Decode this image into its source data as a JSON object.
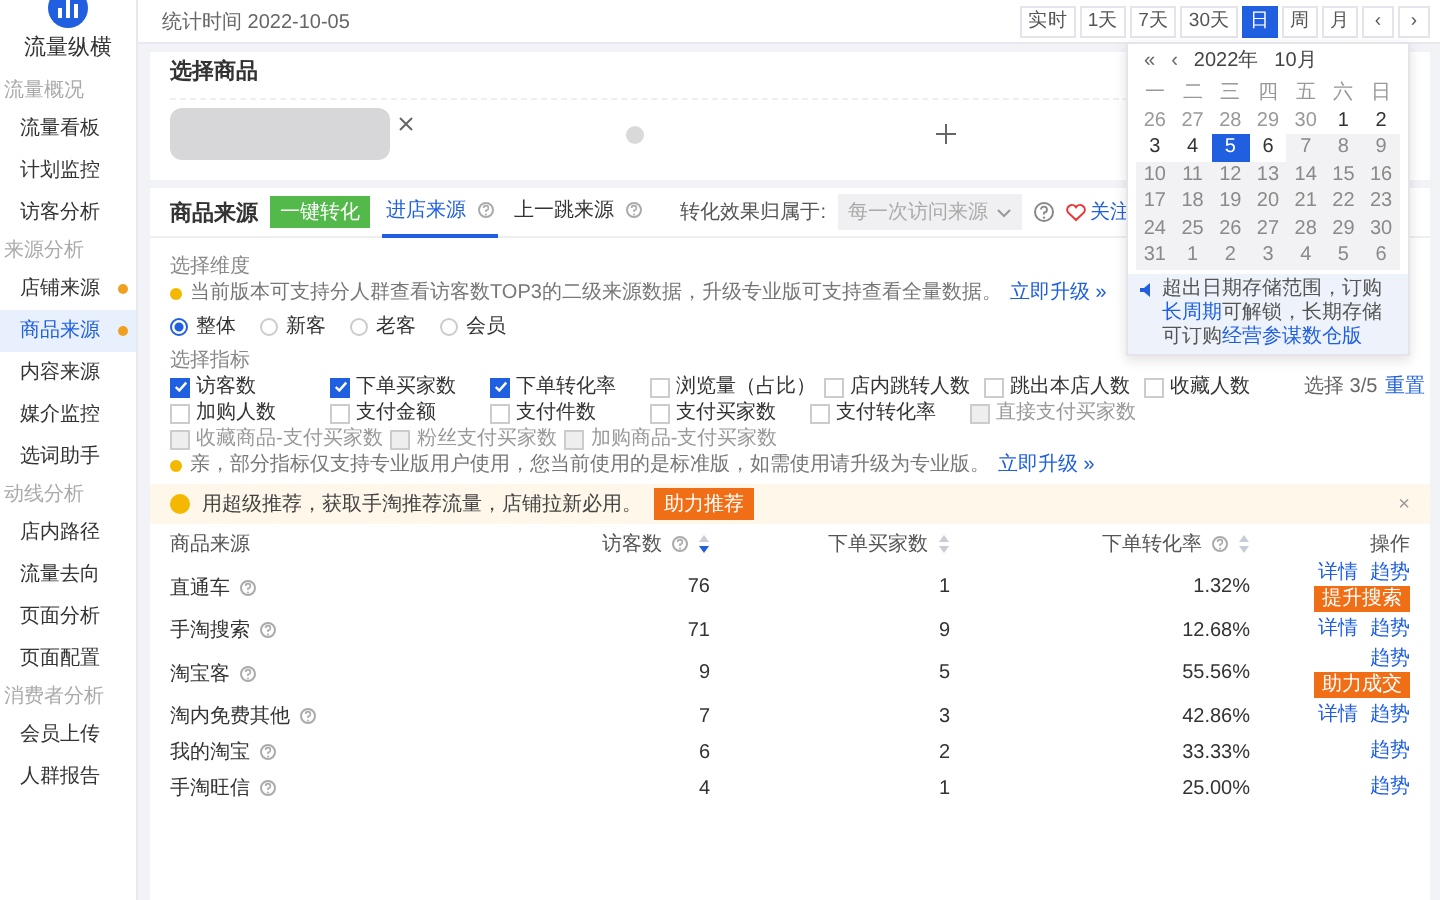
{
  "sidebar": {
    "title": "流量纵横",
    "groups": [
      {
        "label": "流量概况",
        "items": [
          {
            "label": "流量看板",
            "selected": false,
            "dot": false
          },
          {
            "label": "计划监控",
            "selected": false,
            "dot": false
          },
          {
            "label": "访客分析",
            "selected": false,
            "dot": false
          }
        ]
      },
      {
        "label": "来源分析",
        "items": [
          {
            "label": "店铺来源",
            "selected": false,
            "dot": true
          },
          {
            "label": "商品来源",
            "selected": true,
            "dot": true
          },
          {
            "label": "内容来源",
            "selected": false,
            "dot": false
          },
          {
            "label": "媒介监控",
            "selected": false,
            "dot": false
          },
          {
            "label": "选词助手",
            "selected": false,
            "dot": false
          }
        ]
      },
      {
        "label": "动线分析",
        "items": [
          {
            "label": "店内路径",
            "selected": false,
            "dot": false
          },
          {
            "label": "流量去向",
            "selected": false,
            "dot": false
          },
          {
            "label": "页面分析",
            "selected": false,
            "dot": false
          },
          {
            "label": "页面配置",
            "selected": false,
            "dot": false
          }
        ]
      },
      {
        "label": "消费者分析",
        "items": [
          {
            "label": "会员上传",
            "selected": false,
            "dot": false
          },
          {
            "label": "人群报告",
            "selected": false,
            "dot": false
          }
        ]
      }
    ]
  },
  "topbar": {
    "stat_label": "统计时间 2022-10-05",
    "buttons": [
      {
        "label": "实时",
        "selected": false
      },
      {
        "label": "1天",
        "selected": false
      },
      {
        "label": "7天",
        "selected": false
      },
      {
        "label": "30天",
        "selected": false
      },
      {
        "label": "日",
        "selected": true
      },
      {
        "label": "周",
        "selected": false
      },
      {
        "label": "月",
        "selected": false
      },
      {
        "label": "‹",
        "selected": false
      },
      {
        "label": "›",
        "selected": false
      }
    ]
  },
  "calendar": {
    "year": "2022年",
    "month": "10月",
    "prev_year": "«",
    "prev_month": "‹",
    "weekdays": [
      "一",
      "二",
      "三",
      "四",
      "五",
      "六",
      "日"
    ],
    "days": [
      {
        "label": "26",
        "other_month": true,
        "disabled": false,
        "selected": false
      },
      {
        "label": "27",
        "other_month": true,
        "disabled": false,
        "selected": false
      },
      {
        "label": "28",
        "other_month": true,
        "disabled": false,
        "selected": false
      },
      {
        "label": "29",
        "other_month": true,
        "disabled": false,
        "selected": false
      },
      {
        "label": "30",
        "other_month": true,
        "disabled": false,
        "selected": false
      },
      {
        "label": "1",
        "other_month": false,
        "disabled": false,
        "selected": false
      },
      {
        "label": "2",
        "other_month": false,
        "disabled": false,
        "selected": false
      },
      {
        "label": "3",
        "other_month": false,
        "disabled": false,
        "selected": false
      },
      {
        "label": "4",
        "other_month": false,
        "disabled": false,
        "selected": false
      },
      {
        "label": "5",
        "other_month": false,
        "disabled": false,
        "selected": true
      },
      {
        "label": "6",
        "other_month": false,
        "disabled": false,
        "selected": false
      },
      {
        "label": "7",
        "other_month": false,
        "disabled": true,
        "selected": false
      },
      {
        "label": "8",
        "other_month": false,
        "disabled": true,
        "selected": false
      },
      {
        "label": "9",
        "other_month": false,
        "disabled": true,
        "selected": false
      },
      {
        "label": "10",
        "other_month": false,
        "disabled": true,
        "selected": false
      },
      {
        "label": "11",
        "other_month": false,
        "disabled": true,
        "selected": false
      },
      {
        "label": "12",
        "other_month": false,
        "disabled": true,
        "selected": false
      },
      {
        "label": "13",
        "other_month": false,
        "disabled": true,
        "selected": false
      },
      {
        "label": "14",
        "other_month": false,
        "disabled": true,
        "selected": false
      },
      {
        "label": "15",
        "other_month": false,
        "disabled": true,
        "selected": false
      },
      {
        "label": "16",
        "other_month": false,
        "disabled": true,
        "selected": false
      },
      {
        "label": "17",
        "other_month": false,
        "disabled": true,
        "selected": false
      },
      {
        "label": "18",
        "other_month": false,
        "disabled": true,
        "selected": false
      },
      {
        "label": "19",
        "other_month": false,
        "disabled": true,
        "selected": false
      },
      {
        "label": "20",
        "other_month": false,
        "disabled": true,
        "selected": false
      },
      {
        "label": "21",
        "other_month": false,
        "disabled": true,
        "selected": false
      },
      {
        "label": "22",
        "other_month": false,
        "disabled": true,
        "selected": false
      },
      {
        "label": "23",
        "other_month": false,
        "disabled": true,
        "selected": false
      },
      {
        "label": "24",
        "other_month": false,
        "disabled": true,
        "selected": false
      },
      {
        "label": "25",
        "other_month": false,
        "disabled": true,
        "selected": false
      },
      {
        "label": "26",
        "other_month": false,
        "disabled": true,
        "selected": false
      },
      {
        "label": "27",
        "other_month": false,
        "disabled": true,
        "selected": false
      },
      {
        "label": "28",
        "other_month": false,
        "disabled": true,
        "selected": false
      },
      {
        "label": "29",
        "other_month": false,
        "disabled": true,
        "selected": false
      },
      {
        "label": "30",
        "other_month": false,
        "disabled": true,
        "selected": false
      },
      {
        "label": "31",
        "other_month": false,
        "disabled": true,
        "selected": false
      },
      {
        "label": "1",
        "other_month": true,
        "disabled": true,
        "selected": false
      },
      {
        "label": "2",
        "other_month": true,
        "disabled": true,
        "selected": false
      },
      {
        "label": "3",
        "other_month": true,
        "disabled": true,
        "selected": false
      },
      {
        "label": "4",
        "other_month": true,
        "disabled": true,
        "selected": false
      },
      {
        "label": "5",
        "other_month": true,
        "disabled": true,
        "selected": false
      },
      {
        "label": "6",
        "other_month": true,
        "disabled": true,
        "selected": false
      }
    ],
    "notice": [
      {
        "text": "超出日期存储范围，订购",
        "link": false
      },
      {
        "text": "长周期",
        "link": true
      },
      {
        "text": "可解锁，长期存储可订购",
        "link": false
      },
      {
        "text": "经营参谋数仓版",
        "link": true
      }
    ]
  },
  "product_picker": {
    "title": "选择商品"
  },
  "source_panel": {
    "title": "商品来源",
    "convert_button": "一键转化",
    "tabs": [
      {
        "label": "进店来源",
        "selected": true
      },
      {
        "label": "上一跳来源",
        "selected": false
      }
    ],
    "attribution_label": "转化效果归属于:",
    "attribution_select": "每一次访问来源",
    "follow": "关注",
    "dimension_label": "选择维度",
    "dimension_notice": "当前版本可支持分人群查看访客数TOP3的二级来源数据，升级专业版可支持查看全量数据。",
    "dimension_link": "立即升级 »",
    "segments": [
      {
        "label": "整体",
        "selected": true
      },
      {
        "label": "新客",
        "selected": false
      },
      {
        "label": "老客",
        "selected": false
      },
      {
        "label": "会员",
        "selected": false
      }
    ],
    "metric_label": "选择指标",
    "metric_count": "选择 3/5",
    "reset": "重置",
    "metric_rows": [
      [
        {
          "label": "访客数",
          "checked": true,
          "disabled": false
        },
        {
          "label": "下单买家数",
          "checked": true,
          "disabled": false
        },
        {
          "label": "下单转化率",
          "checked": true,
          "disabled": false
        },
        {
          "label": "浏览量（占比）",
          "checked": false,
          "disabled": false
        },
        {
          "label": "店内跳转人数",
          "checked": false,
          "disabled": false
        },
        {
          "label": "跳出本店人数",
          "checked": false,
          "disabled": false
        },
        {
          "label": "收藏人数",
          "checked": false,
          "disabled": false
        }
      ],
      [
        {
          "label": "加购人数",
          "checked": false,
          "disabled": false
        },
        {
          "label": "支付金额",
          "checked": false,
          "disabled": false
        },
        {
          "label": "支付件数",
          "checked": false,
          "disabled": false
        },
        {
          "label": "支付买家数",
          "checked": false,
          "disabled": false
        },
        {
          "label": "支付转化率",
          "checked": false,
          "disabled": false
        },
        {
          "label": "直接支付买家数",
          "checked": false,
          "disabled": true
        }
      ],
      [
        {
          "label": "收藏商品-支付买家数",
          "checked": false,
          "disabled": true
        },
        {
          "label": "粉丝支付买家数",
          "checked": false,
          "disabled": true
        },
        {
          "label": "加购商品-支付买家数",
          "checked": false,
          "disabled": true
        }
      ]
    ],
    "metric_notice": "亲，部分指标仅支持专业版用户使用，您当前使用的是标准版，如需使用请升级为专业版。",
    "metric_link": "立即升级 »"
  },
  "banner": {
    "text": "用超级推荐，获取手淘推荐流量，店铺拉新必用。",
    "button": "助力推荐",
    "close": "×"
  },
  "table": {
    "columns": [
      {
        "label": "商品来源"
      },
      {
        "label": "访客数",
        "help": true,
        "sortable": true,
        "sorted": true
      },
      {
        "label": "下单买家数",
        "sortable": true,
        "sorted": false
      },
      {
        "label": "下单转化率",
        "help": true,
        "sortable": true,
        "sorted": false
      },
      {
        "label": "操作"
      }
    ],
    "rows": [
      {
        "source": "直通车",
        "visitors": "76",
        "buyers": "1",
        "rate": "1.32%",
        "actions": [
          {
            "label": "详情",
            "kind": "link"
          },
          {
            "label": "趋势",
            "kind": "link"
          },
          {
            "label": "提升搜索",
            "kind": "button"
          }
        ]
      },
      {
        "source": "手淘搜索",
        "visitors": "71",
        "buyers": "9",
        "rate": "12.68%",
        "actions": [
          {
            "label": "详情",
            "kind": "link"
          },
          {
            "label": "趋势",
            "kind": "link"
          }
        ]
      },
      {
        "source": "淘宝客",
        "visitors": "9",
        "buyers": "5",
        "rate": "55.56%",
        "actions": [
          {
            "label": "趋势",
            "kind": "link"
          },
          {
            "label": "助力成交",
            "kind": "button"
          }
        ]
      },
      {
        "source": "淘内免费其他",
        "visitors": "7",
        "buyers": "3",
        "rate": "42.86%",
        "actions": [
          {
            "label": "详情",
            "kind": "link"
          },
          {
            "label": "趋势",
            "kind": "link"
          }
        ]
      },
      {
        "source": "我的淘宝",
        "visitors": "6",
        "buyers": "2",
        "rate": "33.33%",
        "actions": [
          {
            "label": "趋势",
            "kind": "link"
          }
        ]
      },
      {
        "source": "手淘旺信",
        "visitors": "4",
        "buyers": "1",
        "rate": "25.00%",
        "actions": [
          {
            "label": "趋势",
            "kind": "link"
          }
        ]
      }
    ]
  }
}
